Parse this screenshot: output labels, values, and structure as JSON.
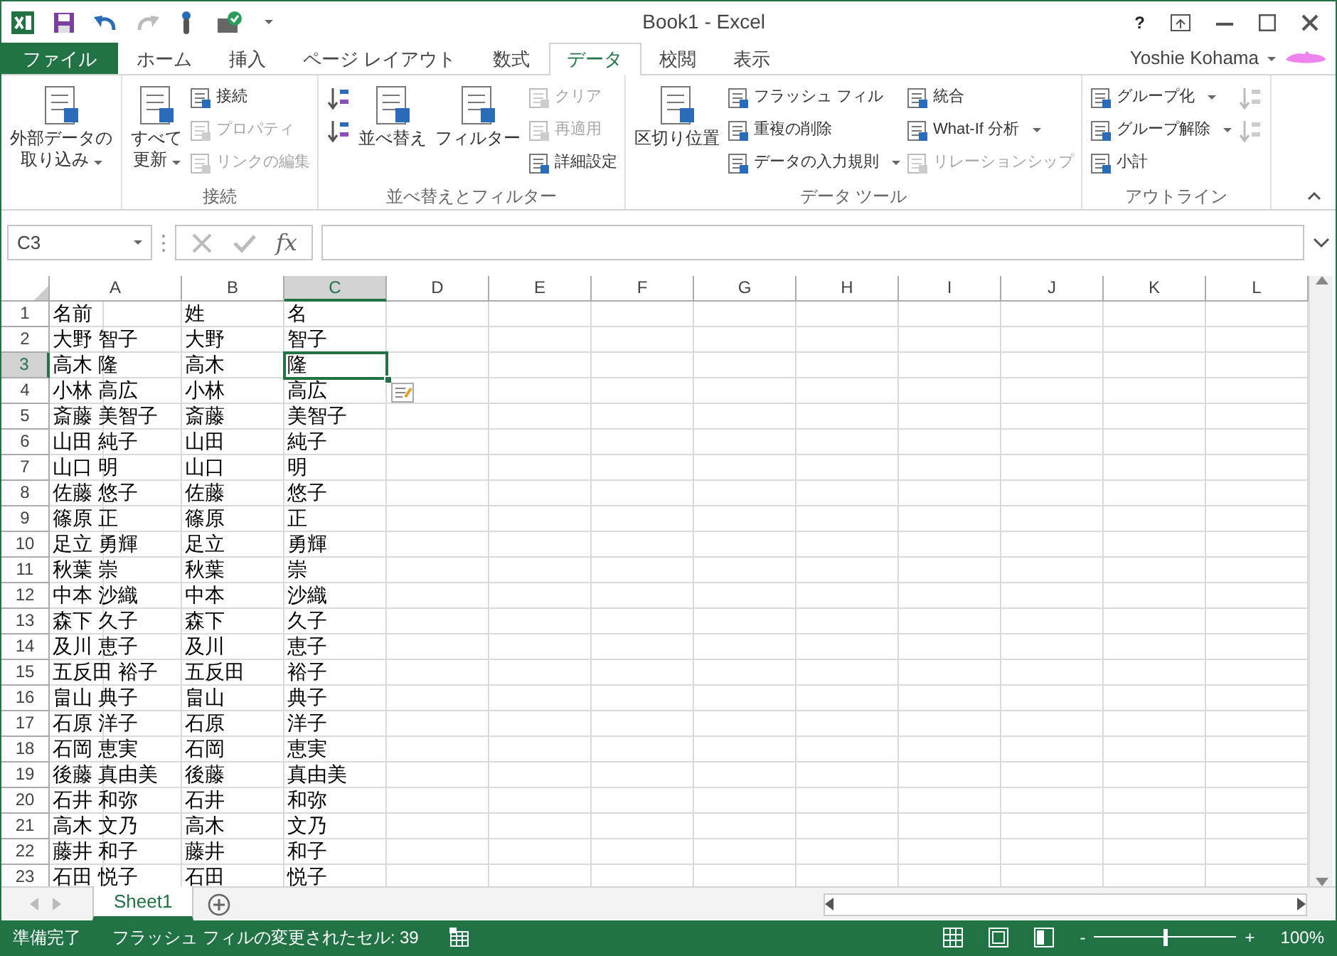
{
  "window": {
    "title": "Book1 - Excel",
    "help": "?"
  },
  "tabs": [
    {
      "label": "ファイル",
      "kind": "file",
      "selected": false
    },
    {
      "label": "ホーム",
      "kind": "tab",
      "selected": false
    },
    {
      "label": "挿入",
      "kind": "tab",
      "selected": false
    },
    {
      "label": "ページ レイアウト",
      "kind": "tab",
      "selected": false
    },
    {
      "label": "数式",
      "kind": "tab",
      "selected": false
    },
    {
      "label": "データ",
      "kind": "tab",
      "selected": true
    },
    {
      "label": "校閲",
      "kind": "tab",
      "selected": false
    },
    {
      "label": "表示",
      "kind": "tab",
      "selected": false
    }
  ],
  "user": "Yoshie Kohama",
  "ribbon": [
    {
      "columns": [
        {
          "kind": "large",
          "label_lines": [
            "外部データの",
            "取り込み"
          ],
          "dropdown": true,
          "disabled": false
        }
      ]
    },
    {
      "label": "接続",
      "columns": [
        {
          "kind": "large",
          "label_lines": [
            "すべて",
            "更新"
          ],
          "dropdown": true,
          "disabled": false
        },
        {
          "kind": "stack",
          "items": [
            {
              "kind": "small",
              "label": "接続",
              "disabled": false,
              "dropdown": false
            },
            {
              "kind": "small",
              "label": "プロパティ",
              "disabled": true,
              "dropdown": false
            },
            {
              "kind": "small",
              "label": "リンクの編集",
              "disabled": true,
              "dropdown": false
            }
          ]
        }
      ]
    },
    {
      "label": "並べ替えとフィルター",
      "columns": [
        {
          "kind": "stack",
          "items": [
            {
              "kind": "icon",
              "disabled": false
            },
            {
              "kind": "icon",
              "disabled": false
            }
          ]
        },
        {
          "kind": "large",
          "label_lines": [
            "並べ替え"
          ],
          "dropdown": false,
          "disabled": false
        },
        {
          "kind": "large",
          "label_lines": [
            "フィルター"
          ],
          "dropdown": false,
          "disabled": false
        },
        {
          "kind": "stack",
          "items": [
            {
              "kind": "small",
              "label": "クリア",
              "disabled": true,
              "dropdown": false
            },
            {
              "kind": "small",
              "label": "再適用",
              "disabled": true,
              "dropdown": false
            },
            {
              "kind": "small",
              "label": "詳細設定",
              "disabled": false,
              "dropdown": false
            }
          ]
        }
      ]
    },
    {
      "label": "データ ツール",
      "columns": [
        {
          "kind": "large",
          "label_lines": [
            "区切り位置"
          ],
          "dropdown": false,
          "disabled": false
        },
        {
          "kind": "stack",
          "items": [
            {
              "kind": "small",
              "label": "フラッシュ フィル",
              "disabled": false,
              "dropdown": false
            },
            {
              "kind": "small",
              "label": "重複の削除",
              "disabled": false,
              "dropdown": false
            },
            {
              "kind": "small",
              "label": "データの入力規則",
              "disabled": false,
              "dropdown": true
            }
          ]
        },
        {
          "kind": "stack",
          "items": [
            {
              "kind": "small",
              "label": "統合",
              "disabled": false,
              "dropdown": false
            },
            {
              "kind": "small",
              "label": "What-If 分析",
              "disabled": false,
              "dropdown": true
            },
            {
              "kind": "small",
              "label": "リレーションシップ",
              "disabled": true,
              "dropdown": false
            }
          ]
        }
      ]
    },
    {
      "label": "アウトライン",
      "columns": [
        {
          "kind": "stack",
          "items": [
            {
              "kind": "small",
              "label": "グループ化",
              "disabled": false,
              "dropdown": true
            },
            {
              "kind": "small",
              "label": "グループ解除",
              "disabled": false,
              "dropdown": true
            },
            {
              "kind": "small",
              "label": "小計",
              "disabled": false,
              "dropdown": false
            }
          ]
        },
        {
          "kind": "stack",
          "items": [
            {
              "kind": "icon",
              "disabled": true
            },
            {
              "kind": "icon",
              "disabled": true
            }
          ]
        }
      ]
    }
  ],
  "formula_bar": {
    "name_box": "C3",
    "function_label": "fx"
  },
  "columns": [
    {
      "label": "A",
      "selected": false
    },
    {
      "label": "B",
      "selected": false
    },
    {
      "label": "C",
      "selected": true
    },
    {
      "label": "D",
      "selected": false
    },
    {
      "label": "E",
      "selected": false
    },
    {
      "label": "F",
      "selected": false
    },
    {
      "label": "G",
      "selected": false
    },
    {
      "label": "H",
      "selected": false
    },
    {
      "label": "I",
      "selected": false
    },
    {
      "label": "J",
      "selected": false
    },
    {
      "label": "K",
      "selected": false
    },
    {
      "label": "L",
      "selected": false
    }
  ],
  "rows": [
    {
      "number": "1",
      "selected": false,
      "cells": [
        "名前",
        "姓",
        "名"
      ]
    },
    {
      "number": "2",
      "selected": false,
      "cells": [
        "大野 智子",
        "大野",
        "智子"
      ]
    },
    {
      "number": "3",
      "selected": true,
      "cells": [
        "高木 隆",
        "高木",
        "隆"
      ]
    },
    {
      "number": "4",
      "selected": false,
      "cells": [
        "小林 高広",
        "小林",
        "高広"
      ]
    },
    {
      "number": "5",
      "selected": false,
      "cells": [
        "斎藤 美智子",
        "斎藤",
        "美智子"
      ]
    },
    {
      "number": "6",
      "selected": false,
      "cells": [
        "山田 純子",
        "山田",
        "純子"
      ]
    },
    {
      "number": "7",
      "selected": false,
      "cells": [
        "山口 明",
        "山口",
        "明"
      ]
    },
    {
      "number": "8",
      "selected": false,
      "cells": [
        "佐藤 悠子",
        "佐藤",
        "悠子"
      ]
    },
    {
      "number": "9",
      "selected": false,
      "cells": [
        "篠原 正",
        "篠原",
        "正"
      ]
    },
    {
      "number": "10",
      "selected": false,
      "cells": [
        "足立 勇輝",
        "足立",
        "勇輝"
      ]
    },
    {
      "number": "11",
      "selected": false,
      "cells": [
        "秋葉 崇",
        "秋葉",
        "崇"
      ]
    },
    {
      "number": "12",
      "selected": false,
      "cells": [
        "中本 沙織",
        "中本",
        "沙織"
      ]
    },
    {
      "number": "13",
      "selected": false,
      "cells": [
        "森下 久子",
        "森下",
        "久子"
      ]
    },
    {
      "number": "14",
      "selected": false,
      "cells": [
        "及川 恵子",
        "及川",
        "恵子"
      ]
    },
    {
      "number": "15",
      "selected": false,
      "cells": [
        "五反田 裕子",
        "五反田",
        "裕子"
      ]
    },
    {
      "number": "16",
      "selected": false,
      "cells": [
        "畠山 典子",
        "畠山",
        "典子"
      ]
    },
    {
      "number": "17",
      "selected": false,
      "cells": [
        "石原 洋子",
        "石原",
        "洋子"
      ]
    },
    {
      "number": "18",
      "selected": false,
      "cells": [
        "石岡 恵実",
        "石岡",
        "恵実"
      ]
    },
    {
      "number": "19",
      "selected": false,
      "cells": [
        "後藤 真由美",
        "後藤",
        "真由美"
      ]
    },
    {
      "number": "20",
      "selected": false,
      "cells": [
        "石井 和弥",
        "石井",
        "和弥"
      ]
    },
    {
      "number": "21",
      "selected": false,
      "cells": [
        "高木 文乃",
        "高木",
        "文乃"
      ]
    },
    {
      "number": "22",
      "selected": false,
      "cells": [
        "藤井 和子",
        "藤井",
        "和子"
      ]
    },
    {
      "number": "23",
      "selected": false,
      "cells": [
        "石田 悦子",
        "石田",
        "悦子"
      ]
    }
  ],
  "sheet_tabs": [
    {
      "label": "Sheet1",
      "selected": true
    }
  ],
  "status_bar": {
    "mode": "準備完了",
    "message": "フラッシュ フィルの変更されたセル: 39",
    "zoom_minus": "-",
    "zoom_plus": "+",
    "zoom": {
      "level": 0.5
    },
    "zoom_reading": "100%"
  }
}
